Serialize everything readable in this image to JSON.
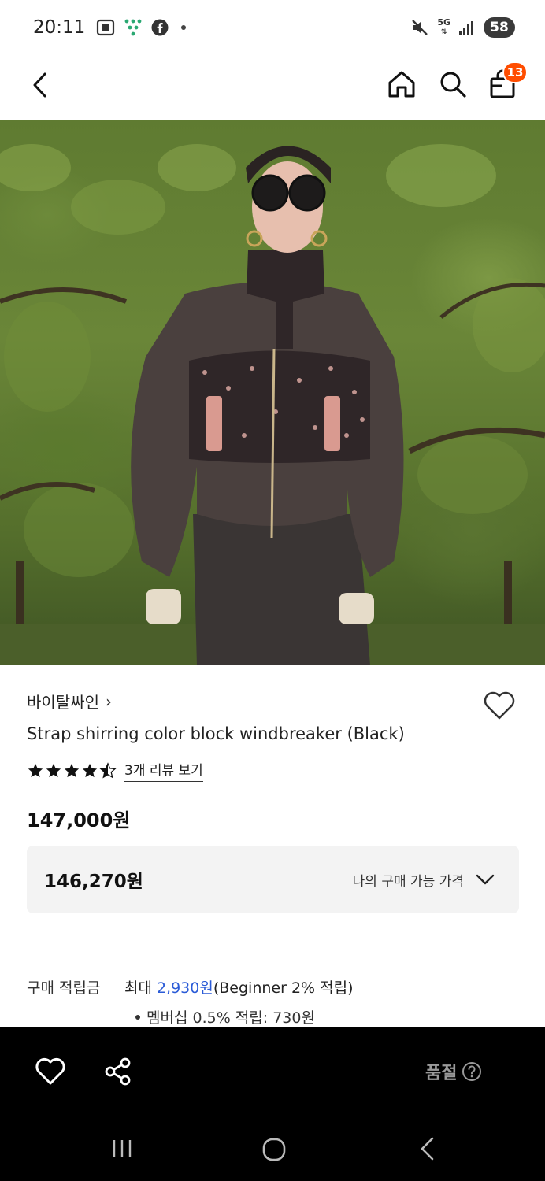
{
  "status_bar": {
    "time": "20:11",
    "network": "5G",
    "battery": "58"
  },
  "header": {
    "cart_count": "13"
  },
  "product": {
    "brand": "바이탈싸인",
    "brand_chevron": "›",
    "title": "Strap shirring color block windbreaker (Black)",
    "rating_stars": 4.5,
    "review_link": "3개 리뷰 보기",
    "price_original": "147,000원",
    "price_member": "146,270원",
    "price_member_label": "나의 구매 가능 가격"
  },
  "points": {
    "label": "구매 적립금",
    "max_prefix": "최대",
    "amount": "2,930원",
    "note": "(Beginner 2% 적립)",
    "membership_line": "멤버십 0.5% 적립: 730원"
  },
  "action_bar": {
    "status_label": "품절"
  },
  "colors": {
    "accent_blue": "#2a5bd7",
    "cart_badge": "#ff4d00",
    "action_bar_bg": "#000000",
    "price_box_bg": "#f3f3f3"
  },
  "icons": {
    "back": "chevron-left-icon",
    "home": "home-icon",
    "search": "search-icon",
    "cart": "shopping-bag-icon",
    "wishlist": "heart-icon",
    "share": "share-icon",
    "help": "question-icon",
    "dropdown": "chevron-down-icon"
  }
}
